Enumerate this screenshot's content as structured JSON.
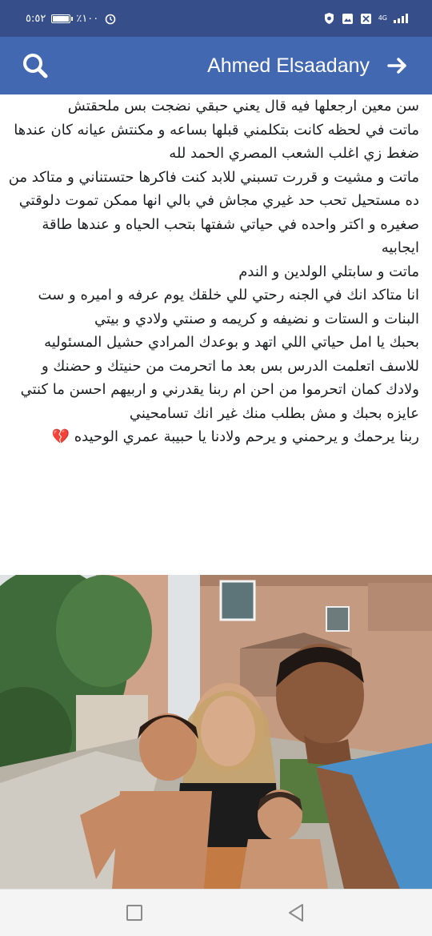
{
  "status_bar": {
    "time": "٥:٥٢",
    "battery": "٪١٠٠",
    "battery_level_fraction": 1.0,
    "network": "4G",
    "icons": [
      "alarm-icon",
      "battery-icon",
      "signal-icon",
      "shield-icon",
      "photo-icon",
      "notification-icon"
    ]
  },
  "header": {
    "title": "Ahmed Elsaadany",
    "back_icon": "arrow-right-icon",
    "search_icon": "search-icon"
  },
  "post": {
    "lines": [
      "سن معين ارجعلها فيه قال يعني حبقي نضجت بس ملحقتش",
      "ماتت في لحظه كانت بتكلمني قبلها بساعه و مكنتش عيانه كان عندها ضغط زي اغلب الشعب المصري الحمد لله",
      "ماتت و مشيت و قررت تسبني للابد كنت فاكرها حتستناني و متاكد من ده مستحيل تحب حد غيري مجاش في بالي انها ممكن تموت دلوقتي صغيره و اكتر واحده في حياتي شفتها بتحب الحياه و عندها طاقة ايجابيه",
      "ماتت و سابتلي الولدين و الندم",
      "انا متاكد انك في الجنه رحتي للي خلقك يوم عرفه و اميره و ست البنات و الستات و نضيفه و كريمه و صنتي ولادي و بيتي",
      "بحبك يا امل حياتي اللي اتهد و بوعدك المرادي حشيل المسئوليه للاسف اتعلمت الدرس بس بعد ما اتحرمت من حنيتك و حضنك و ولادك كمان اتحرموا من احن ام ربنا يقدرني و اربيهم احسن ما كنتي عايزه بحبك و مش بطلب منك غير انك تسامحيني",
      "ربنا يرحمك و يرحمني و يرحم ولادنا يا حبيبة عمري الوحيده 💔"
    ]
  },
  "photo": {
    "icon": "family-photo"
  },
  "nav_bar": {
    "recent_icon": "square-icon",
    "back_icon": "triangle-back-icon"
  },
  "colors": {
    "status_bar": "#364f8a",
    "app_bar": "#4268b2",
    "text": "#1c1e21",
    "nav_bar": "#f4f4f4"
  }
}
